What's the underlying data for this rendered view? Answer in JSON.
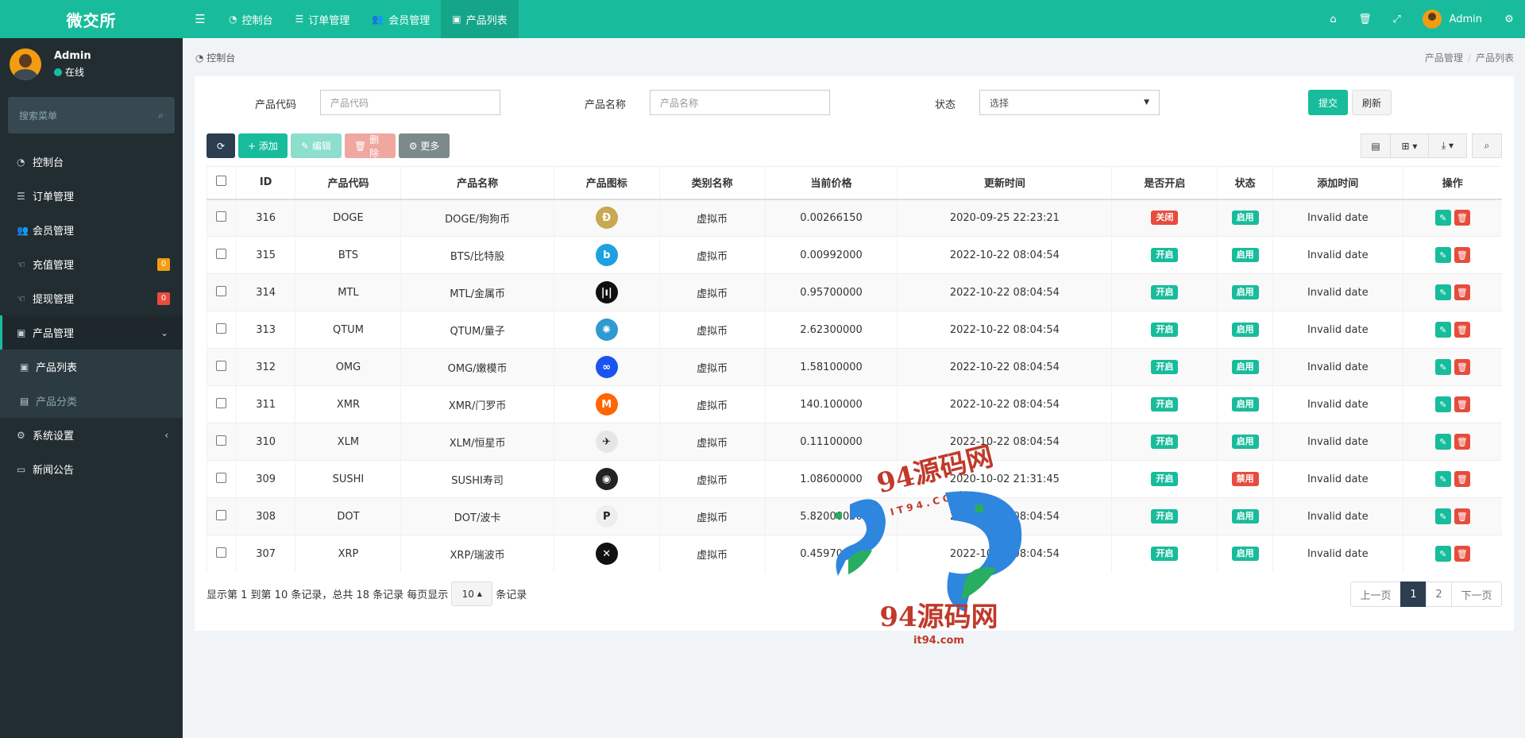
{
  "app": {
    "title": "微交所"
  },
  "user": {
    "name": "Admin",
    "status": "在线"
  },
  "sidebar": {
    "search_placeholder": "搜索菜单",
    "items": [
      {
        "label": "控制台",
        "icon": "dashboard-icon"
      },
      {
        "label": "订单管理",
        "icon": "list-icon"
      },
      {
        "label": "会员管理",
        "icon": "users-icon"
      },
      {
        "label": "充值管理",
        "icon": "hand-icon",
        "badge": "0",
        "badge_color": "#f39c12"
      },
      {
        "label": "提现管理",
        "icon": "hand-icon",
        "badge": "0",
        "badge_color": "#e74c3c"
      },
      {
        "label": "产品管理",
        "icon": "shopping-bag-icon"
      },
      {
        "label": "产品列表",
        "icon": "shopping-bag-icon"
      },
      {
        "label": "产品分类",
        "icon": "list-alt-icon"
      },
      {
        "label": "系统设置",
        "icon": "cogs-icon"
      },
      {
        "label": "新闻公告",
        "icon": "newspaper-icon"
      }
    ]
  },
  "topbar": {
    "tabs": [
      {
        "label": "控制台"
      },
      {
        "label": "订单管理"
      },
      {
        "label": "会员管理"
      },
      {
        "label": "产品列表"
      }
    ],
    "user_name": "Admin"
  },
  "breadcrumb": {
    "left": "控制台",
    "right": [
      "产品管理",
      "产品列表"
    ]
  },
  "filter": {
    "code_label": "产品代码",
    "code_placeholder": "产品代码",
    "name_label": "产品名称",
    "name_placeholder": "产品名称",
    "status_label": "状态",
    "status_value": "选择",
    "submit": "提交",
    "reset": "刷新"
  },
  "toolbar": {
    "add": "添加",
    "edit": "编辑",
    "delete": "删除",
    "more": "更多"
  },
  "table": {
    "headers": [
      "ID",
      "产品代码",
      "产品名称",
      "产品图标",
      "类别名称",
      "当前价格",
      "更新时间",
      "是否开启",
      "状态",
      "添加时间",
      "操作"
    ],
    "rows": [
      {
        "id": "316",
        "code": "DOGE",
        "name": "DOGE/狗狗币",
        "category": "虚拟币",
        "price": "0.00266150",
        "updated": "2020-09-25 22:23:21",
        "open": "关闭",
        "open_color": "red",
        "status": "启用",
        "status_color": "green",
        "added": "Invalid date",
        "icon_color": "#c8a951",
        "icon_glyph": "Ð"
      },
      {
        "id": "315",
        "code": "BTS",
        "name": "BTS/比特股",
        "category": "虚拟币",
        "price": "0.00992000",
        "updated": "2022-10-22 08:04:54",
        "open": "开启",
        "open_color": "green",
        "status": "启用",
        "status_color": "green",
        "added": "Invalid date",
        "icon_color": "#1da1e0",
        "icon_glyph": "b"
      },
      {
        "id": "314",
        "code": "MTL",
        "name": "MTL/金属币",
        "category": "虚拟币",
        "price": "0.95700000",
        "updated": "2022-10-22 08:04:54",
        "open": "开启",
        "open_color": "green",
        "status": "启用",
        "status_color": "green",
        "added": "Invalid date",
        "icon_color": "#111111",
        "icon_glyph": "|ı|"
      },
      {
        "id": "313",
        "code": "QTUM",
        "name": "QTUM/量子",
        "category": "虚拟币",
        "price": "2.62300000",
        "updated": "2022-10-22 08:04:54",
        "open": "开启",
        "open_color": "green",
        "status": "启用",
        "status_color": "green",
        "added": "Invalid date",
        "icon_color": "#2e9ad0",
        "icon_glyph": "✺"
      },
      {
        "id": "312",
        "code": "OMG",
        "name": "OMG/嫩模币",
        "category": "虚拟币",
        "price": "1.58100000",
        "updated": "2022-10-22 08:04:54",
        "open": "开启",
        "open_color": "green",
        "status": "启用",
        "status_color": "green",
        "added": "Invalid date",
        "icon_color": "#1a53f0",
        "icon_glyph": "∞"
      },
      {
        "id": "311",
        "code": "XMR",
        "name": "XMR/门罗币",
        "category": "虚拟币",
        "price": "140.100000",
        "updated": "2022-10-22 08:04:54",
        "open": "开启",
        "open_color": "green",
        "status": "启用",
        "status_color": "green",
        "added": "Invalid date",
        "icon_color": "#ff6600",
        "icon_glyph": "M"
      },
      {
        "id": "310",
        "code": "XLM",
        "name": "XLM/恒星币",
        "category": "虚拟币",
        "price": "0.11100000",
        "updated": "2022-10-22 08:04:54",
        "open": "开启",
        "open_color": "green",
        "status": "启用",
        "status_color": "green",
        "added": "Invalid date",
        "icon_color": "#e6e6e6",
        "icon_glyph": "✈"
      },
      {
        "id": "309",
        "code": "SUSHI",
        "name": "SUSHI寿司",
        "category": "虚拟币",
        "price": "1.08600000",
        "updated": "2020-10-02 21:31:45",
        "open": "开启",
        "open_color": "green",
        "status": "禁用",
        "status_color": "red",
        "added": "Invalid date",
        "icon_color": "#222222",
        "icon_glyph": "◉"
      },
      {
        "id": "308",
        "code": "DOT",
        "name": "DOT/波卡",
        "category": "虚拟币",
        "price": "5.82000000",
        "updated": "2022-10-22 08:04:54",
        "open": "开启",
        "open_color": "green",
        "status": "启用",
        "status_color": "green",
        "added": "Invalid date",
        "icon_color": "#eeeeee",
        "icon_glyph": "P"
      },
      {
        "id": "307",
        "code": "XRP",
        "name": "XRP/瑞波币",
        "category": "虚拟币",
        "price": "0.45970000",
        "updated": "2022-10-22 08:04:54",
        "open": "开启",
        "open_color": "green",
        "status": "启用",
        "status_color": "green",
        "added": "Invalid date",
        "icon_color": "#111111",
        "icon_glyph": "✕"
      }
    ]
  },
  "footer": {
    "info_pre": "显示第 1 到第 10 条记录，总共 18 条记录 每页显示",
    "page_size": "10",
    "info_post": "条记录"
  },
  "pagination": {
    "prev": "上一页",
    "pages": [
      "1",
      "2"
    ],
    "next": "下一页"
  },
  "watermark": {
    "text": "94源码网",
    "url": "it94.com",
    "sub": "I T 9 4 . C O M"
  },
  "colors": {
    "primary": "#18bc9c",
    "sidebar": "#222d32",
    "danger": "#e74c3c",
    "dark": "#2c3e50"
  }
}
